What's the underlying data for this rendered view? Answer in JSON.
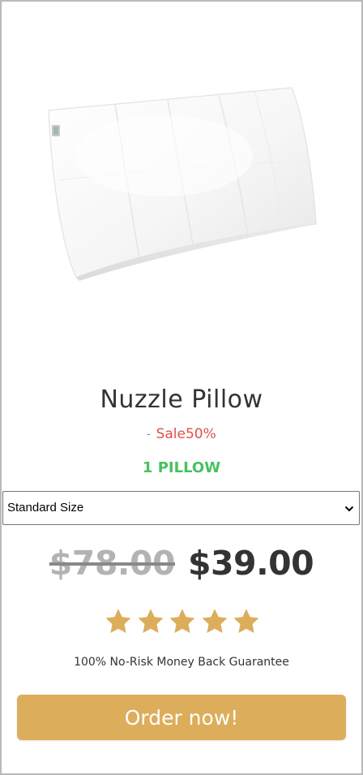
{
  "product": {
    "image_icon": "pillow-product-image",
    "title": "Nuzzle Pillow",
    "sale_dash": "-",
    "sale_label": "Sale50%",
    "bundle_label": "1 PILLOW"
  },
  "size_select": {
    "selected": "Standard Size",
    "icon": "chevron-down-icon"
  },
  "pricing": {
    "old_price": "$78.00",
    "new_price": "$39.00"
  },
  "rating": {
    "stars": 5,
    "max": 5,
    "icon": "star-icon"
  },
  "guarantee": "100% No-Risk Money Back Guarantee",
  "cta": {
    "label": "Order now!"
  },
  "colors": {
    "accent": "#dcad5b",
    "sale": "#e0504a",
    "bundle": "#48c160",
    "star": "#dcad5b",
    "text": "#333333",
    "old_price": "#b3b3b3"
  }
}
